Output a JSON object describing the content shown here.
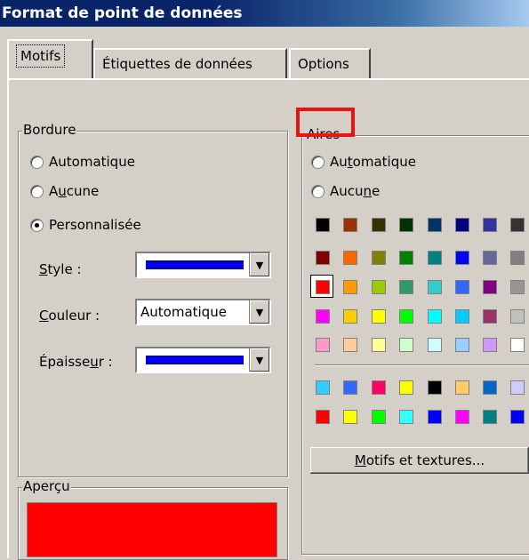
{
  "window": {
    "title": "Format de point de données"
  },
  "tabs": [
    {
      "label": "Motifs",
      "active": true
    },
    {
      "label": "Étiquettes de données",
      "active": false
    },
    {
      "label": "Options",
      "active": false
    }
  ],
  "bordure": {
    "legend": "Bordure",
    "options": [
      {
        "pre": "Automatique",
        "u": "",
        "post": "",
        "checked": false
      },
      {
        "pre": "A",
        "u": "u",
        "post": "cune",
        "checked": false
      },
      {
        "pre": "Personnalisée",
        "u": "",
        "post": "",
        "checked": true
      }
    ],
    "style": {
      "u": "S",
      "rest": "tyle :"
    },
    "couleur": {
      "u": "C",
      "rest": "ouleur :",
      "value": "Automatique"
    },
    "epaisseur": {
      "pre": "Épaisse",
      "u": "u",
      "post": "r :"
    }
  },
  "aires": {
    "legend": "Aires",
    "automatique": {
      "pre": "Au",
      "u": "t",
      "post": "omatique"
    },
    "aucune": {
      "pre": "Aucu",
      "u": "n",
      "post": "e"
    },
    "palette_rows": [
      [
        "#000000",
        "#993300",
        "#333300",
        "#003300",
        "#003366",
        "#000080",
        "#333399",
        "#333333"
      ],
      [
        "#800000",
        "#ff6600",
        "#808000",
        "#008000",
        "#008080",
        "#0000ff",
        "#666699",
        "#808080"
      ],
      [
        "#ff0000",
        "#ff9900",
        "#99cc00",
        "#339966",
        "#33cccc",
        "#3366ff",
        "#800080",
        "#969696"
      ],
      [
        "#ff00ff",
        "#ffcc00",
        "#ffff00",
        "#00ff00",
        "#00ffff",
        "#00ccff",
        "#993366",
        "#c0c0c0"
      ],
      [
        "#ff99cc",
        "#ffcc99",
        "#ffff99",
        "#ccffcc",
        "#ccffff",
        "#99ccff",
        "#cc99ff",
        "#ffffff"
      ]
    ],
    "extra_rows": [
      [
        "#33ccff",
        "#3366ff",
        "#ff0066",
        "#ffff00",
        "#000000",
        "#ffcc66",
        "#0066cc",
        "#ccccff"
      ],
      [
        "#ff0000",
        "#ffff00",
        "#00ff00",
        "#33ffff",
        "#0000ff",
        "#ff00ff",
        "#008080",
        "#0000ff"
      ]
    ],
    "selected": {
      "row": 2,
      "col": 0
    },
    "motifs_button": {
      "u": "M",
      "rest": "otifs et textures..."
    }
  },
  "apercu": {
    "legend": "Aperçu",
    "fill_color": "#ff0000"
  }
}
